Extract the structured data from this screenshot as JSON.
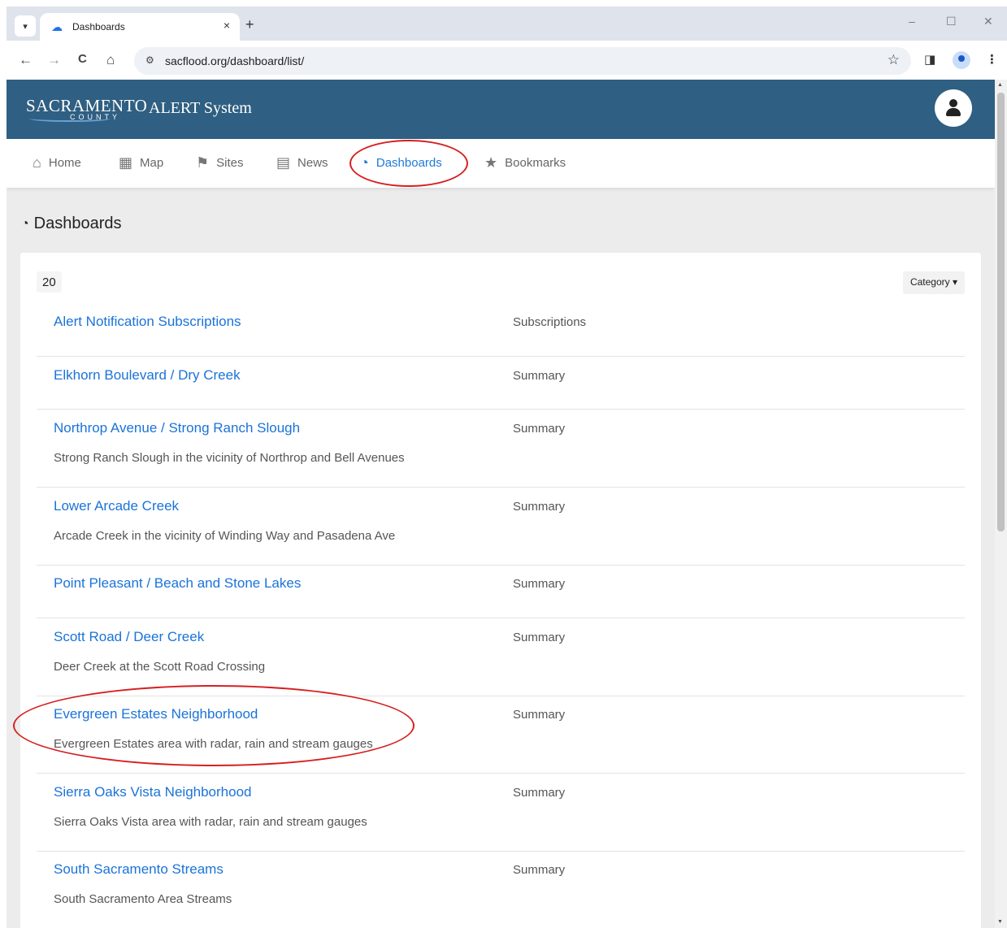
{
  "browser": {
    "tab_title": "Dashboards",
    "tab_close": "×",
    "new_tab": "+",
    "url": "sacflood.org/dashboard/list/",
    "window_controls": {
      "minimize": "–",
      "maximize": "☐",
      "close": "✕"
    },
    "nav": {
      "back": "←",
      "forward": "→",
      "reload": "C",
      "home": "⌂"
    },
    "star": "☆",
    "menu": "⋮",
    "sidepanel": "◨"
  },
  "header": {
    "logo_main": "SACRAMENTO",
    "logo_sub": "COUNTY",
    "site_name": "ALERT System"
  },
  "navbar": {
    "items": [
      {
        "label": "Home",
        "icon": "home-icon",
        "glyph": "⌂"
      },
      {
        "label": "Map",
        "icon": "map-icon",
        "glyph": "▦"
      },
      {
        "label": "Sites",
        "icon": "flag-icon",
        "glyph": "⚑"
      },
      {
        "label": "News",
        "icon": "newspaper-icon",
        "glyph": "▤"
      },
      {
        "label": "Dashboards",
        "icon": "gauge-icon",
        "glyph": "◔",
        "active": true
      },
      {
        "label": "Bookmarks",
        "icon": "bookmark-icon",
        "glyph": "★"
      }
    ]
  },
  "page": {
    "title": "Dashboards",
    "count": "20",
    "category_button": "Category ▾"
  },
  "dashboards": [
    {
      "name": "Alert Notification Subscriptions",
      "description": "",
      "category": "Subscriptions"
    },
    {
      "name": "Elkhorn Boulevard / Dry Creek",
      "description": "",
      "category": "Summary"
    },
    {
      "name": "Northrop Avenue / Strong Ranch Slough",
      "description": "Strong Ranch Slough in the vicinity of Northrop and Bell Avenues",
      "category": "Summary"
    },
    {
      "name": "Lower Arcade Creek",
      "description": "Arcade Creek in the vicinity of Winding Way and Pasadena Ave",
      "category": "Summary"
    },
    {
      "name": "Point Pleasant / Beach and Stone Lakes",
      "description": "",
      "category": "Summary"
    },
    {
      "name": "Scott Road / Deer Creek",
      "description": "Deer Creek at the Scott Road Crossing",
      "category": "Summary"
    },
    {
      "name": "Evergreen Estates Neighborhood",
      "description": "Evergreen Estates area with radar, rain and stream gauges",
      "category": "Summary"
    },
    {
      "name": "Sierra Oaks Vista Neighborhood",
      "description": "Sierra Oaks Vista area with radar, rain and stream gauges",
      "category": "Summary"
    },
    {
      "name": "South Sacramento Streams",
      "description": "South Sacramento Area Streams",
      "category": "Summary"
    }
  ],
  "colors": {
    "header": "#2f5f82",
    "link": "#1a73d9",
    "annotation": "#d61f1f"
  }
}
